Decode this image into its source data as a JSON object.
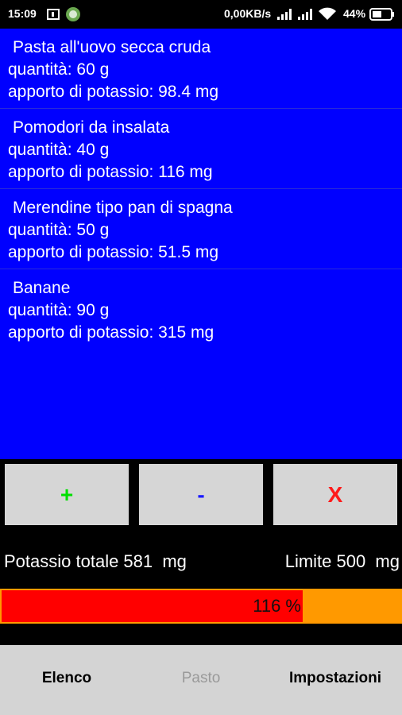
{
  "status_bar": {
    "time": "15:09",
    "network_speed": "0,00KB/s",
    "battery": "44%"
  },
  "food_items": [
    {
      "name": "Pasta all'uovo secca cruda",
      "quantity": "quantità: 60 g",
      "potassium": "apporto di potassio: 98.4 mg"
    },
    {
      "name": "Pomodori da insalata",
      "quantity": "quantità: 40 g",
      "potassium": "apporto di potassio: 116 mg"
    },
    {
      "name": "Merendine tipo pan di spagna",
      "quantity": "quantità: 50 g",
      "potassium": "apporto di potassio: 51.5 mg"
    },
    {
      "name": "Banane",
      "quantity": "quantità: 90 g",
      "potassium": "apporto di potassio: 315 mg"
    }
  ],
  "actions": {
    "add_label": "+",
    "remove_label": "-",
    "clear_label": "X"
  },
  "totals": {
    "total_text": "Potassio totale 581  mg",
    "limit_text": "Limite 500  mg"
  },
  "progress": {
    "label": "116 %",
    "fill_fraction": 0.755
  },
  "nav": {
    "tab_elenco": "Elenco",
    "tab_pasto": "Pasto",
    "tab_impostazioni": "Impostazioni"
  },
  "colors": {
    "list_bg": "#0000ff",
    "add": "#00e000",
    "remove": "#1a1aff",
    "clear": "#ff1a1a",
    "progress_fill": "#ff0000",
    "progress_track": "#ff9900"
  }
}
